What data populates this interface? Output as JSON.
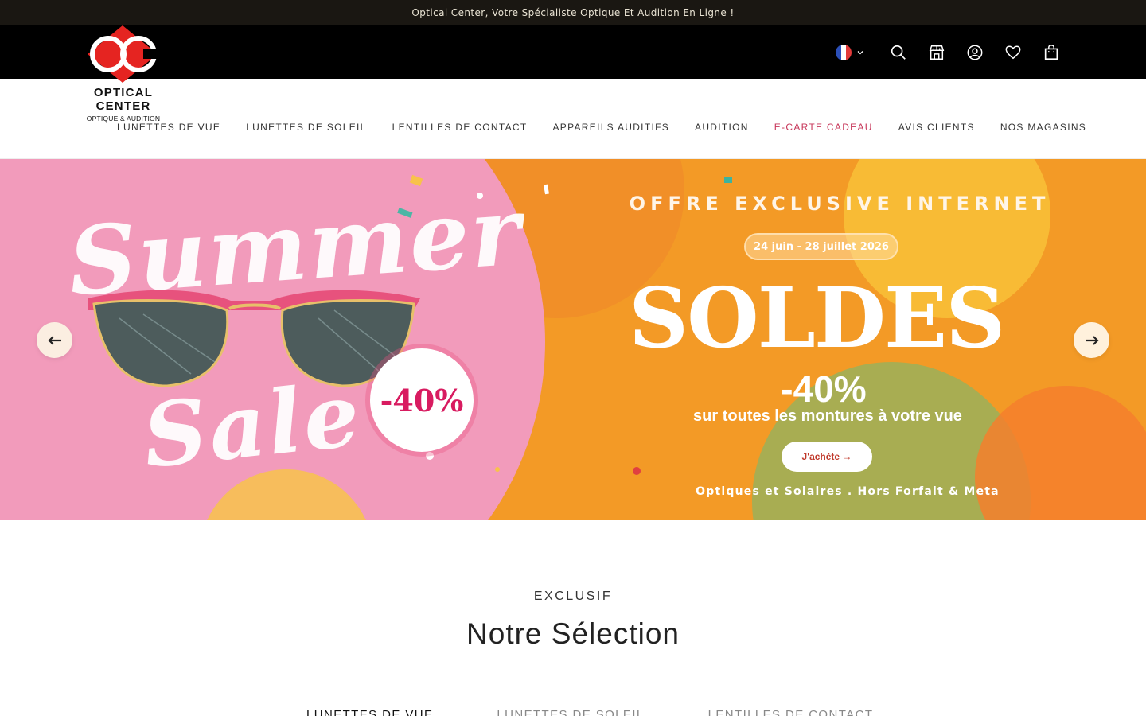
{
  "announcement": "Optical Center, Votre Spécialiste Optique Et Audition En Ligne !",
  "brand": {
    "name": "OPTICAL CENTER",
    "tagline": "OPTIQUE & AUDITION",
    "logo_colors": {
      "red": "#e52421",
      "white": "#ffffff"
    }
  },
  "header": {
    "icons": [
      "flag-fr-icon",
      "chevron-down-icon",
      "search-icon",
      "store-icon",
      "account-icon",
      "heart-icon",
      "bag-icon"
    ]
  },
  "nav": {
    "items": [
      {
        "label": "LUNETTES DE VUE"
      },
      {
        "label": "LUNETTES DE SOLEIL"
      },
      {
        "label": "LENTILLES DE CONTACT"
      },
      {
        "label": "APPAREILS AUDITIFS"
      },
      {
        "label": "AUDITION"
      },
      {
        "label": "E-CARTE CADEAU"
      },
      {
        "label": "AVIS CLIENTS"
      },
      {
        "label": "NOS MAGASINS"
      }
    ],
    "accent_color": "#c7375a"
  },
  "hero": {
    "offer_heading": "OFFRE EXCLUSIVE INTERNET",
    "dates": "24 juin - 28 juillet 2026",
    "headline": "SOLDES",
    "discount": "-40%",
    "subline": "sur toutes les montures à votre vue",
    "cta": "J'achète →",
    "footnote": "Optiques et Solaires . Hors Forfait & Meta",
    "script_top": "Summer",
    "script_bottom": "Sale",
    "badge": "-40%",
    "colors": {
      "pink": "#f29bbb",
      "orange": "#f39a26",
      "green": "#a8ad52"
    }
  },
  "section": {
    "kicker": "EXCLUSIF",
    "title": "Notre Sélection",
    "tabs": [
      "LUNETTES DE VUE",
      "LUNETTES DE SOLEIL",
      "LENTILLES DE CONTACT"
    ]
  }
}
